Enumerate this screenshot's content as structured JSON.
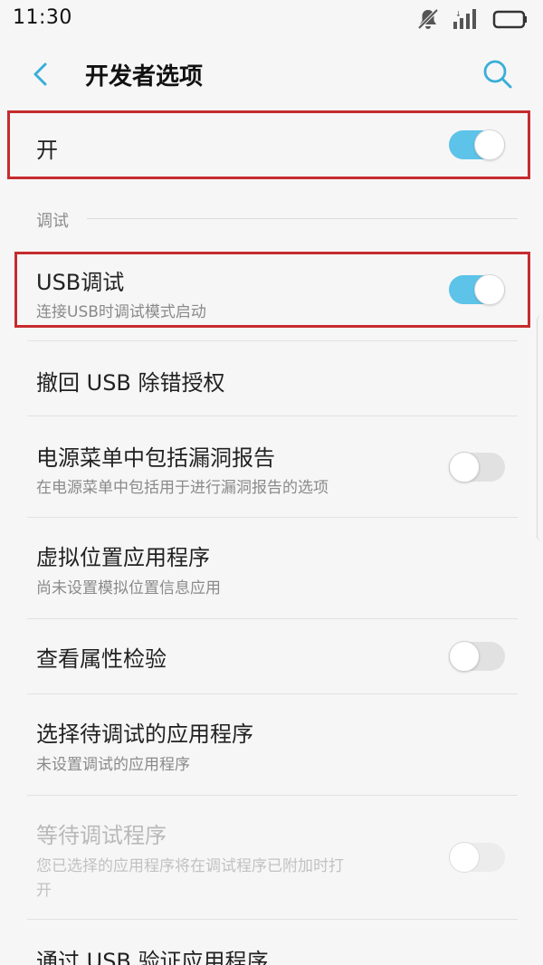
{
  "status_bar": {
    "time": "11:30",
    "icons": [
      "notifications-muted-icon",
      "signal-icon",
      "battery-icon"
    ]
  },
  "app_bar": {
    "title": "开发者选项",
    "back_icon": "chevron-left-icon",
    "search_icon": "search-icon"
  },
  "colors": {
    "accent": "#5dc3e8",
    "highlight_border": "#c62b2f",
    "background": "#f6f6f6"
  },
  "master_switch": {
    "label": "开",
    "state": "on"
  },
  "section": {
    "title": "调试"
  },
  "settings": [
    {
      "title": "USB调试",
      "subtitle": "连接USB时调试模式启动",
      "toggle": "on"
    },
    {
      "title": "撤回 USB 除错授权",
      "subtitle": "",
      "toggle": "none"
    },
    {
      "title": "电源菜单中包括漏洞报告",
      "subtitle": "在电源菜单中包括用于进行漏洞报告的选项",
      "toggle": "off"
    },
    {
      "title": "虚拟位置应用程序",
      "subtitle": "尚未设置模拟位置信息应用",
      "toggle": "none"
    },
    {
      "title": "查看属性检验",
      "subtitle": "",
      "toggle": "off"
    },
    {
      "title": "选择待调试的应用程序",
      "subtitle": "未设置调试的应用程序",
      "toggle": "none"
    },
    {
      "title": "等待调试程序",
      "subtitle_line1": "您已选择的应用程序将在调试程序已附加时打",
      "subtitle_line2": "开",
      "toggle": "disabled-off"
    },
    {
      "title": "通过 USB 验证应用程序",
      "subtitle": "",
      "toggle": "none"
    }
  ]
}
